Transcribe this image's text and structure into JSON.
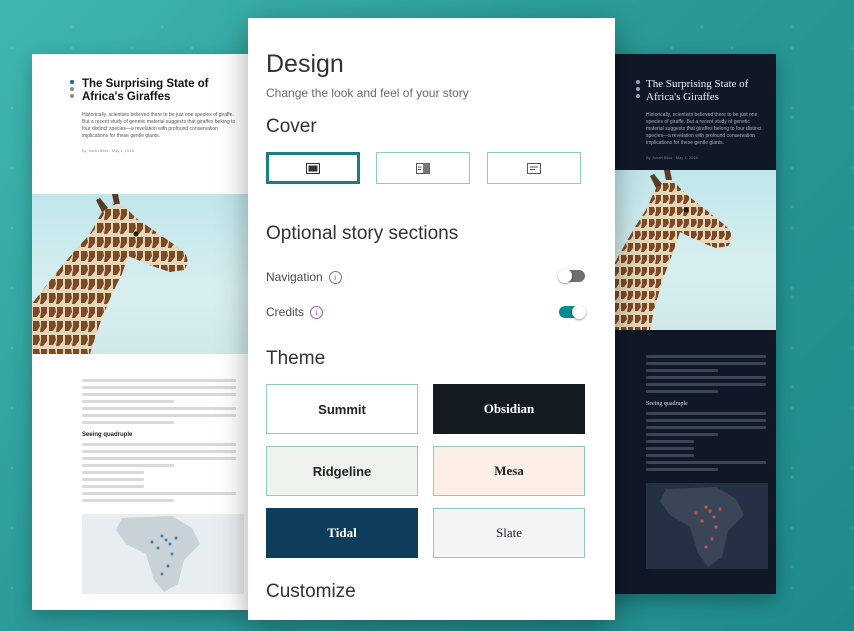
{
  "preview_left": {
    "title": "The Surprising State of Africa's Giraffes",
    "subtitle": "Historically, scientists believed there to be just one species of giraffe. But a recent study of genetic material suggests that giraffes belong to four distinct species—a revelation with profound conservation implications for these gentle giants.",
    "byline": "By Jonah Bliss · May 1, 2018",
    "section_heading": "Seeing quadruple",
    "colors": {
      "nav_dot_1": "#1a5e8f",
      "nav_dot_2": "#8c8c8c",
      "nav_dot_3": "#8c8c8c"
    }
  },
  "preview_right": {
    "title": "The Surprising State of Africa's Giraffes",
    "subtitle": "Historically, scientists believed there to be just one species of giraffe. But a recent study of genetic material suggests that giraffes belong to four distinct species—a revelation with profound conservation implications for these gentle giants.",
    "byline": "By Jonah Bliss · May 1, 2018",
    "section_heading": "Seeing quadruple",
    "colors": {
      "background": "#101828",
      "nav_dot": "#9aa6b8"
    }
  },
  "panel": {
    "title": "Design",
    "subtitle": "Change the look and feel of your story",
    "cover": {
      "heading": "Cover",
      "options": [
        {
          "icon": "cover-full-icon",
          "selected": true
        },
        {
          "icon": "cover-side-icon",
          "selected": false
        },
        {
          "icon": "cover-minimal-icon",
          "selected": false
        }
      ]
    },
    "sections": {
      "heading": "Optional story sections",
      "navigation": {
        "label": "Navigation",
        "enabled": false
      },
      "credits": {
        "label": "Credits",
        "enabled": true
      }
    },
    "theme": {
      "heading": "Theme",
      "options": [
        {
          "label": "Summit",
          "bg": "#ffffff",
          "fg": "#222222",
          "border": "#8fc9c6"
        },
        {
          "label": "Obsidian",
          "bg": "#141a22",
          "fg": "#ffffff",
          "border": "#141a22"
        },
        {
          "label": "Ridgeline",
          "bg": "#eef2ec",
          "fg": "#222222",
          "border": "#8fc9c6"
        },
        {
          "label": "Mesa",
          "bg": "#fbefe6",
          "fg": "#222222",
          "border": "#8fc9c6"
        },
        {
          "label": "Tidal",
          "bg": "#0d3c5c",
          "fg": "#ffffff",
          "border": "#0d3c5c"
        },
        {
          "label": "Slate",
          "bg": "#f3f4f5",
          "fg": "#222222",
          "border": "#8fc9c6"
        }
      ]
    },
    "customize": {
      "heading": "Customize"
    },
    "colors": {
      "accent": "#0a8a8a",
      "selected_border": "#1a7f80",
      "info": "#8a5fb4"
    }
  }
}
